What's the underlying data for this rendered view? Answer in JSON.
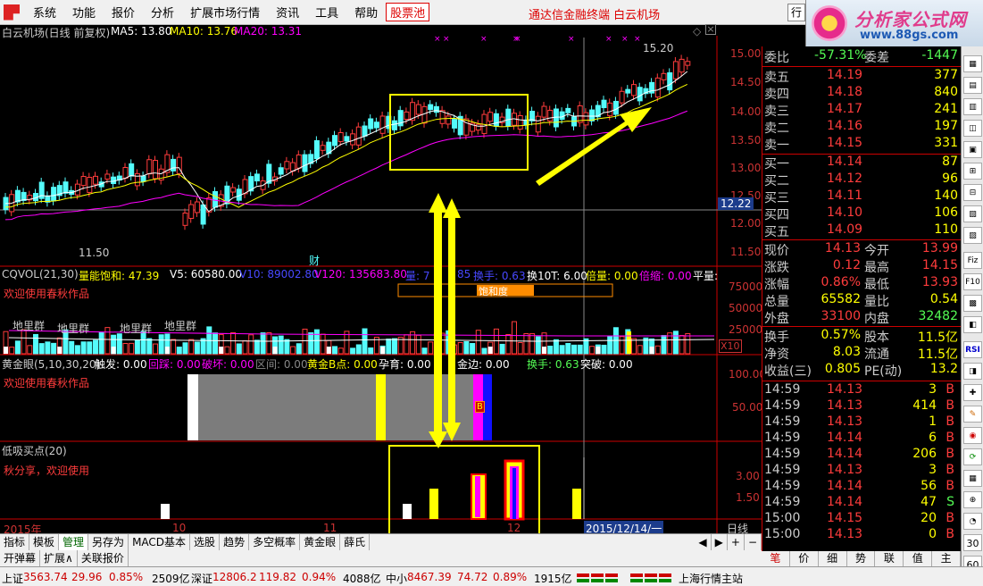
{
  "menu": {
    "items": [
      "系统",
      "功能",
      "报价",
      "分析",
      "扩展市场行情",
      "资讯",
      "工具",
      "帮助"
    ],
    "special": "股票池",
    "center": "通达信金融终端   白云机场",
    "right_btn": "行"
  },
  "logo": {
    "title": "分析家公式网",
    "url": "www.88gs.com"
  },
  "chart": {
    "header": {
      "title": "白云机场(日线 前复权)",
      "ma5": "MA5: 13.80",
      "ma10": "MA10: 13.76",
      "ma20": "MA20: 13.31"
    },
    "price_axis": [
      "15.00",
      "14.50",
      "14.00",
      "13.50",
      "13.00",
      "12.50",
      "12.00",
      "11.50"
    ],
    "current_price_tag": "12.22",
    "high_label": "15.20",
    "low_label": "11.50",
    "finance_mark": "财",
    "vol_header": {
      "name": "CQVOL(21,30)",
      "sat": "量能饱和: 47.39",
      "v5": "V5: 60580.00",
      "v10": "V10: 89002.80",
      "v120": "V120: 135683.80",
      "liang": "量: 7",
      "p85": "85",
      "huanshou": "换手: 0.63",
      "h10t": "换10T: 6.00",
      "beiliang": "倍量: 0.00",
      "beisuo": "倍缩: 0.00",
      "pingliang": "平量:"
    },
    "vol_welcome": "欢迎使用春秋作品",
    "vol_axis": [
      "75000",
      "50000",
      "25000"
    ],
    "vol_scale": "X10",
    "vol_labels": [
      "地里群",
      "地里群",
      "地里群",
      "地里群"
    ],
    "saturation_label": "饱和度",
    "gold_header": {
      "name": "黄金眼(5,10,30,20)",
      "chufa": "触发: 0.00",
      "huixi": "回踩: 0.00",
      "pohuai": "破坏: 0.00",
      "qujian": "区间: 0.00",
      "huangjin": "黄金B点: 0.00",
      "yunyu": "孕育: 0.00",
      "jinbian": "金边: 0.00",
      "huanshou": "换手: 0.63",
      "tupo": "突破: 0.00"
    },
    "gold_welcome": "欢迎使用春秋作品",
    "gold_axis": [
      "100.00",
      "50.00"
    ],
    "gold_b": "B",
    "dixi_header": "低吸买点(20)",
    "dixi_welcome": "秋分享，欢迎使用",
    "dixi_axis": [
      "3.00",
      "1.50"
    ],
    "date_labels": [
      "2015年",
      "10",
      "11",
      "12"
    ],
    "date_cursor": "2015/12/14/一",
    "period": "日线"
  },
  "quote": {
    "weibi": {
      "label": "委比",
      "pct": "-57.31%",
      "label2": "委差",
      "val": "-1447"
    },
    "sells": [
      {
        "label": "卖五",
        "price": "14.19",
        "vol": "377"
      },
      {
        "label": "卖四",
        "price": "14.18",
        "vol": "840"
      },
      {
        "label": "卖三",
        "price": "14.17",
        "vol": "241"
      },
      {
        "label": "卖二",
        "price": "14.16",
        "vol": "197"
      },
      {
        "label": "卖一",
        "price": "14.15",
        "vol": "331"
      }
    ],
    "buys": [
      {
        "label": "买一",
        "price": "14.14",
        "vol": "87"
      },
      {
        "label": "买二",
        "price": "14.12",
        "vol": "96"
      },
      {
        "label": "买三",
        "price": "14.11",
        "vol": "140"
      },
      {
        "label": "买四",
        "price": "14.10",
        "vol": "106"
      },
      {
        "label": "买五",
        "price": "14.09",
        "vol": "110"
      }
    ],
    "stats": [
      {
        "l1": "现价",
        "v1": "14.13",
        "l2": "今开",
        "v2": "13.99"
      },
      {
        "l1": "涨跌",
        "v1": "0.12",
        "l2": "最高",
        "v2": "14.15"
      },
      {
        "l1": "涨幅",
        "v1": "0.86%",
        "l2": "最低",
        "v2": "13.93"
      },
      {
        "l1": "总量",
        "v1": "65582",
        "l2": "量比",
        "v2": "0.54"
      },
      {
        "l1": "外盘",
        "v1": "33100",
        "l2": "内盘",
        "v2": "32482"
      }
    ],
    "stats2": [
      {
        "l1": "换手",
        "v1": "0.57%",
        "l2": "股本",
        "v2": "11.5亿"
      },
      {
        "l1": "净资",
        "v1": "8.03",
        "l2": "流通",
        "v2": "11.5亿"
      },
      {
        "l1": "收益(三)",
        "v1": "0.805",
        "l2": "PE(动)",
        "v2": "13.2"
      }
    ],
    "ticks": [
      {
        "t": "14:59",
        "p": "14.13",
        "v": "3",
        "s": "B"
      },
      {
        "t": "14:59",
        "p": "14.13",
        "v": "414",
        "s": "B"
      },
      {
        "t": "14:59",
        "p": "14.13",
        "v": "1",
        "s": "B"
      },
      {
        "t": "14:59",
        "p": "14.14",
        "v": "6",
        "s": "B"
      },
      {
        "t": "14:59",
        "p": "14.14",
        "v": "206",
        "s": "B"
      },
      {
        "t": "14:59",
        "p": "14.13",
        "v": "3",
        "s": "B"
      },
      {
        "t": "14:59",
        "p": "14.14",
        "v": "56",
        "s": "B"
      },
      {
        "t": "14:59",
        "p": "14.14",
        "v": "47",
        "s": "S"
      },
      {
        "t": "15:00",
        "p": "14.15",
        "v": "20",
        "s": "B"
      },
      {
        "t": "15:00",
        "p": "14.13",
        "v": "0",
        "s": "B"
      }
    ]
  },
  "toolbar_right": [
    "",
    "",
    "",
    "",
    "",
    "",
    "",
    "",
    "",
    "",
    "",
    "RSI",
    "",
    "",
    "",
    "",
    "",
    "",
    "",
    "",
    "",
    "",
    "",
    "30",
    "60"
  ],
  "toolbar_right_named": {
    "t1": "W",
    "t2": "M",
    "t3": "RSI",
    "t4": "30",
    "t5": "60",
    "t6": "Fiz",
    "t7": "F10"
  },
  "tabs": [
    "指标",
    "模板",
    "管理",
    "另存为",
    "MACD基本",
    "选股",
    "趋势",
    "多空概率",
    "黄金眼",
    "薛氏"
  ],
  "tabs2": [
    "开弹幕",
    "扩展∧",
    "关联报价"
  ],
  "right_tabs": [
    "笔",
    "价",
    "细",
    "势",
    "联",
    "值",
    "主"
  ],
  "status": {
    "sh_label": "上证",
    "sh_val": "3563.74",
    "sh_chg": "29.96",
    "sh_pct": "0.85%",
    "sh_amt": "2509亿",
    "sz_label": "深证",
    "sz_val": "12806.2",
    "sz_chg": "119.82",
    "sz_pct": "0.94%",
    "sz_amt": "4088亿",
    "zx_label": "中小",
    "zx_val": "8467.39",
    "zx_chg": "74.72",
    "zx_pct": "0.89%",
    "zx_amt": "1915亿",
    "server": "上海行情主站"
  },
  "colors": {
    "up": "#ff3c3c",
    "down": "#54fcfc",
    "yellow": "#ffff00",
    "ma20": "#ff00ff",
    "ma5": "#ffffff"
  }
}
